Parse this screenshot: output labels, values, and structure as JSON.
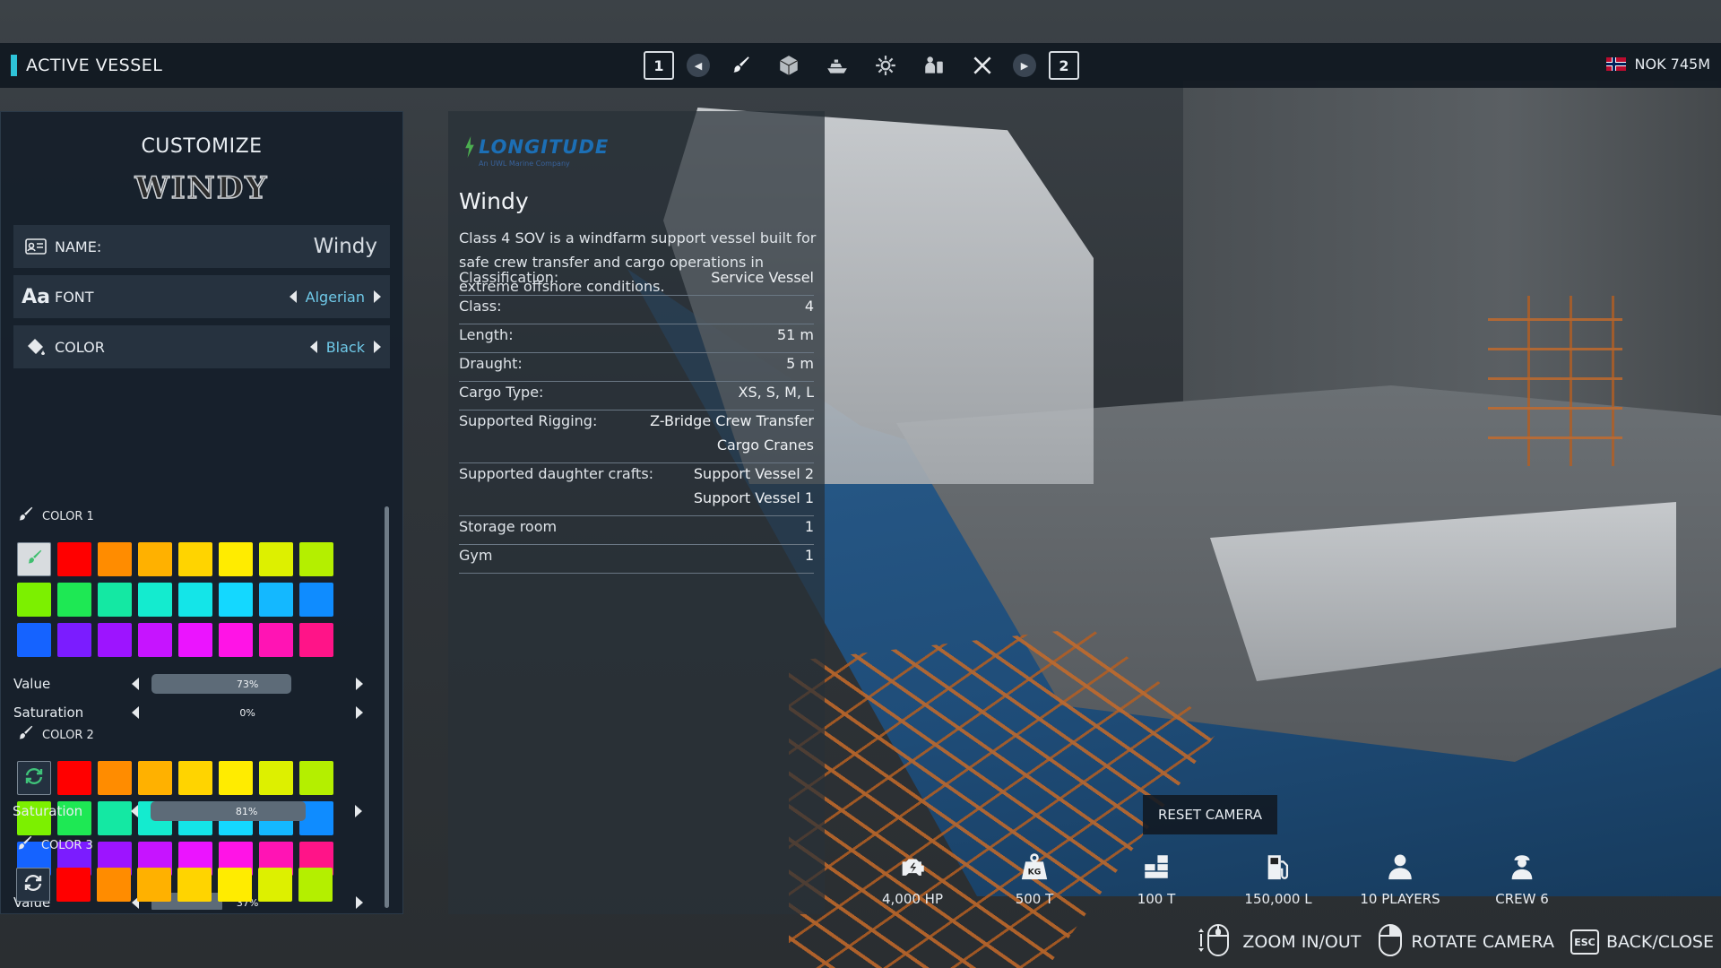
{
  "topbar": {
    "title": "ACTIVE VESSEL",
    "left_key": "1",
    "right_key": "2",
    "tools": [
      "paint-brush-icon",
      "cargo-box-icon",
      "vessel-icon",
      "engine-gear-icon",
      "crew-equipment-icon",
      "tools-icon"
    ],
    "currency": "NOK 745M"
  },
  "customize": {
    "title": "CUSTOMIZE",
    "name_art": "WINDY",
    "name": {
      "label": "NAME:",
      "value": "Windy"
    },
    "font": {
      "label": "FONT",
      "value": "Algerian"
    },
    "color": {
      "label": "COLOR",
      "value": "Black"
    },
    "palette": [
      "#ff0000",
      "#ff8c00",
      "#ffb100",
      "#ffd400",
      "#ffec00",
      "#ddf000",
      "#b4ef00",
      "#7cf000",
      "#1ee854",
      "#14e8a3",
      "#14ebcf",
      "#14e5e8",
      "#14d8ff",
      "#14b8ff",
      "#0f8cff",
      "#1563ff",
      "#7b1cff",
      "#9d14ff",
      "#c614ff",
      "#eb14ff",
      "#ff14e6",
      "#ff14b4",
      "#ff1488"
    ],
    "color1": {
      "label": "COLOR 1",
      "value_label": "Value",
      "value_pct": "73%",
      "value_frac": 0.73,
      "sat_label": "Saturation",
      "sat_pct": "0%",
      "sat_frac": 0.0
    },
    "color2": {
      "label": "COLOR 2",
      "value_label": "Value",
      "value_pct": "37%",
      "value_frac": 0.37,
      "sat_label": "Saturation",
      "sat_pct": "81%",
      "sat_frac": 0.81
    },
    "color3": {
      "label": "COLOR 3"
    }
  },
  "info": {
    "brand": "LONGITUDE",
    "brand_sub": "An UWL Marine Company",
    "vessel_name": "Windy",
    "description": "Class 4 SOV is a windfarm support vessel built for safe crew transfer and cargo operations in extreme offshore conditions.",
    "specs": [
      {
        "key": "Classification:",
        "value": [
          "Service Vessel"
        ]
      },
      {
        "key": "Class:",
        "value": [
          "4"
        ]
      },
      {
        "key": "Length:",
        "value": [
          "51 m"
        ]
      },
      {
        "key": "Draught:",
        "value": [
          "5 m"
        ]
      },
      {
        "key": "Cargo Type:",
        "value": [
          "XS, S, M, L"
        ]
      },
      {
        "key": "Supported Rigging:",
        "value": [
          "Z-Bridge Crew Transfer",
          "Cargo Cranes"
        ]
      },
      {
        "key": "Supported daughter crafts:",
        "value": [
          "Support Vessel 2",
          "Support Vessel 1"
        ]
      },
      {
        "key": "Storage room",
        "value": [
          "1"
        ]
      },
      {
        "key": "Gym",
        "value": [
          "1"
        ]
      }
    ]
  },
  "hud": {
    "reset_camera": "RESET CAMERA",
    "stats": [
      {
        "icon": "engine-icon",
        "value": "4,000 HP"
      },
      {
        "icon": "weight-icon",
        "value": "500 T"
      },
      {
        "icon": "cargo-icon",
        "value": "100 T"
      },
      {
        "icon": "fuel-icon",
        "value": "150,000 L"
      },
      {
        "icon": "players-icon",
        "value": "10 PLAYERS"
      },
      {
        "icon": "crew-icon",
        "value": "CREW 6"
      }
    ],
    "weight_badge": "KG",
    "controls": {
      "zoom": "ZOOM IN/OUT",
      "rotate": "ROTATE CAMERA",
      "esc_key": "ESC",
      "back": "BACK/CLOSE"
    }
  }
}
